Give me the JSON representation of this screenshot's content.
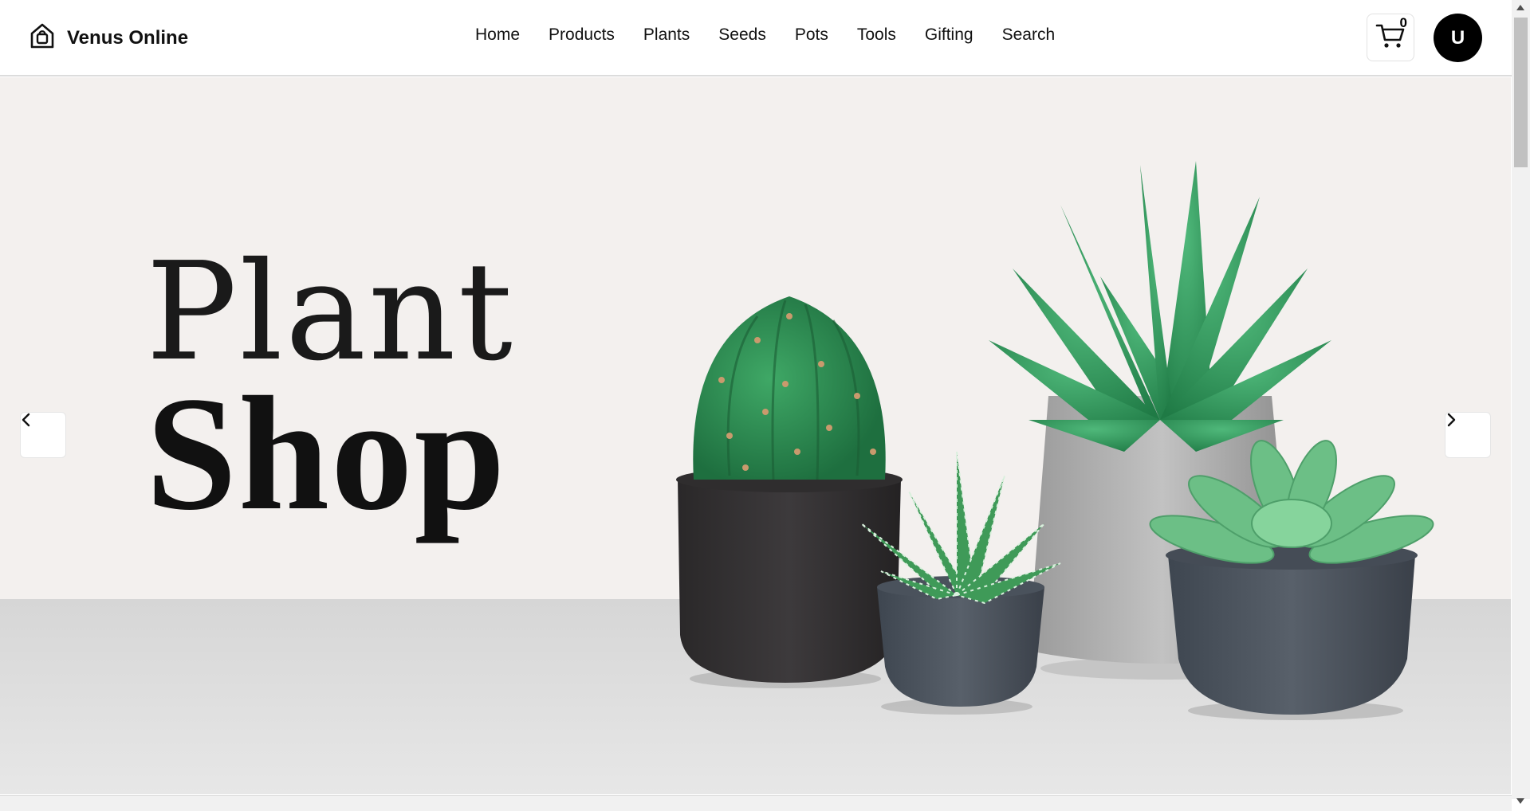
{
  "brand": {
    "name": "Venus Online",
    "icon": "home-bag-icon"
  },
  "nav": {
    "items": [
      "Home",
      "Products",
      "Plants",
      "Seeds",
      "Pots",
      "Tools",
      "Gifting",
      "Search"
    ]
  },
  "cart": {
    "count": "0",
    "icon": "cart-icon"
  },
  "user": {
    "initial": "U"
  },
  "hero": {
    "title_line1": "Plant",
    "title_line2": "Shop",
    "prev_icon": "chevron-left-icon",
    "next_icon": "chevron-right-icon"
  },
  "colors": {
    "hero_background": "#f3f0ee",
    "table_surface": "#dcdcdc",
    "avatar_bg": "#000000",
    "plant_green": "#2f8a55"
  }
}
